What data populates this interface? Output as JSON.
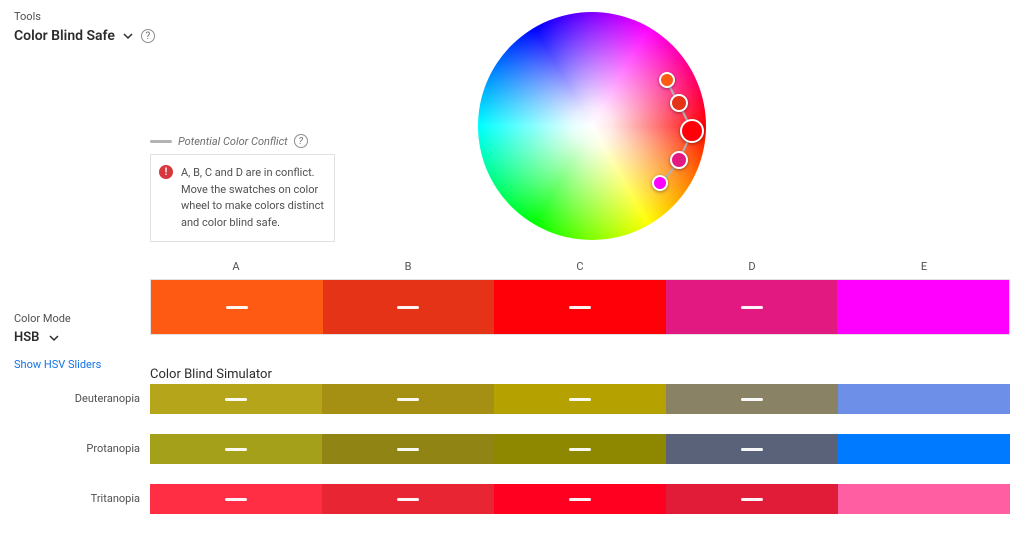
{
  "header": {
    "tools_label": "Tools",
    "tool_name": "Color Blind Safe"
  },
  "legend": {
    "label": "Potential Color Conflict"
  },
  "warning": {
    "text": "A, B, C and D are in conflict. Move the swatches on color wheel to make colors distinct and color blind safe."
  },
  "mode": {
    "label": "Color Mode",
    "value": "HSB",
    "sliders_link": "Show HSV Sliders"
  },
  "palette": {
    "labels": [
      "A",
      "B",
      "C",
      "D",
      "E"
    ],
    "colors": [
      "#FF5A14",
      "#E53317",
      "#FF0008",
      "#E31982",
      "#FF00FF"
    ]
  },
  "simulator": {
    "title": "Color Blind Simulator",
    "rows": [
      {
        "name": "Deuteranopia",
        "colors": [
          "#B5A51A",
          "#A59014",
          "#B5A100",
          "#8A8265",
          "#6E8FE8"
        ]
      },
      {
        "name": "Protanopia",
        "colors": [
          "#A5A01A",
          "#8F8414",
          "#8E8700",
          "#5A627A",
          "#007BFF"
        ]
      },
      {
        "name": "Tritanopia",
        "colors": [
          "#FF2E44",
          "#E82633",
          "#FF0021",
          "#E01C39",
          "#FF5FA2"
        ]
      }
    ]
  },
  "markers": [
    {
      "cls": "m1",
      "x": 83,
      "y": 30,
      "color": "#FF5A14"
    },
    {
      "cls": "m2",
      "x": 88,
      "y": 40,
      "color": "#E53317"
    },
    {
      "cls": "m3",
      "x": 94,
      "y": 52,
      "color": "#FF0008"
    },
    {
      "cls": "m4",
      "x": 88,
      "y": 65,
      "color": "#E31982"
    },
    {
      "cls": "m5",
      "x": 80,
      "y": 75,
      "color": "#FF00FF"
    }
  ]
}
